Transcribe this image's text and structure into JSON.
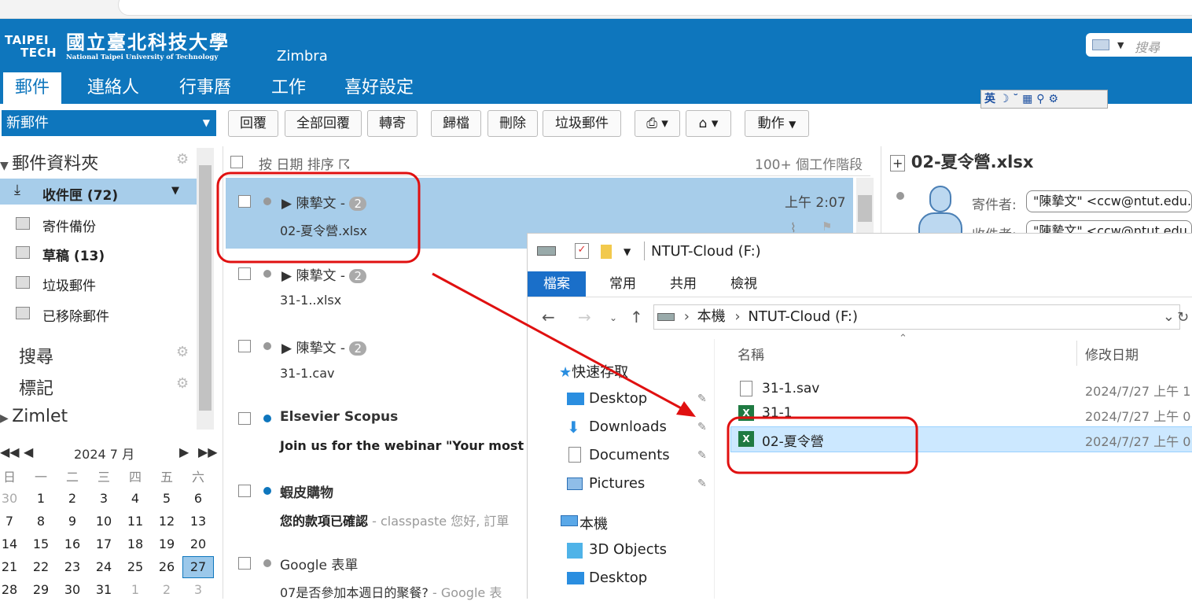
{
  "header": {
    "logo_top": "TAIPEI",
    "logo_bottom": "TECH",
    "logo_cn": "國立臺北科技大學",
    "logo_en": "National Taipei University of Technology",
    "product": "Zimbra",
    "search_placeholder": "搜尋",
    "tabs": [
      "郵件",
      "連絡人",
      "行事曆",
      "工作",
      "喜好設定"
    ],
    "ime": "英 ☽ ˘ ▦ ⚲ ⚙"
  },
  "toolbar": {
    "new_mail": "新郵件",
    "buttons": [
      "回覆",
      "全部回覆",
      "轉寄",
      "歸檔",
      "刪除",
      "垃圾郵件",
      "動作"
    ]
  },
  "sidebar": {
    "folders_header": "郵件資料夾",
    "folders": [
      {
        "label": "收件匣 (72)"
      },
      {
        "label": "寄件備份"
      },
      {
        "label": "草稿 (13)"
      },
      {
        "label": "垃圾郵件"
      },
      {
        "label": "已移除郵件"
      }
    ],
    "search": "搜尋",
    "tags": "標記",
    "zimlet": "Zimlet"
  },
  "calendar": {
    "month_label": "2024 7 月",
    "weekdays": [
      "日",
      "一",
      "二",
      "三",
      "四",
      "五",
      "六"
    ],
    "weeks": [
      [
        "30",
        "1",
        "2",
        "3",
        "4",
        "5",
        "6"
      ],
      [
        "7",
        "8",
        "9",
        "10",
        "11",
        "12",
        "13"
      ],
      [
        "14",
        "15",
        "16",
        "17",
        "18",
        "19",
        "20"
      ],
      [
        "21",
        "22",
        "23",
        "24",
        "25",
        "26",
        "27"
      ],
      [
        "28",
        "29",
        "30",
        "31",
        "1",
        "2",
        "3"
      ]
    ],
    "today": "27"
  },
  "list": {
    "sort_label": "按 日期 排序 ☈",
    "count_label": "100+ 個工作階段",
    "messages": [
      {
        "sender": "陳摯文 -",
        "count": "2",
        "subject": "02-夏令營.xlsx",
        "time": "上午 2:07"
      },
      {
        "sender": "陳摯文 -",
        "count": "2",
        "subject": "31-1..xlsx"
      },
      {
        "sender": "陳摯文 -",
        "count": "2",
        "subject": "31-1.cav"
      },
      {
        "sender": "Elsevier Scopus",
        "subject": "Join us for the webinar \"Your most as"
      },
      {
        "sender": "蝦皮購物",
        "subject": "您的款項已確認",
        "fragment": "- classpaste 您好, 訂單"
      },
      {
        "sender": "Google 表單",
        "subject": "07是否參加本週日的聚餐?",
        "fragment": "- Google 表"
      }
    ]
  },
  "reading": {
    "title": "02-夏令營.xlsx",
    "from_label": "寄件者:",
    "from_value": "\"陳摯文\" <ccw@ntut.edu.",
    "to_label": "收件者:",
    "to_value": "\"陳摯文\" <ccw@ntut.edu."
  },
  "explorer": {
    "title": "NTUT-Cloud (F:)",
    "ribbon": [
      "檔案",
      "常用",
      "共用",
      "檢視"
    ],
    "path_root": "本機",
    "path_drive": "NTUT-Cloud (F:)",
    "col_name": "名稱",
    "col_date": "修改日期",
    "tree": [
      {
        "label": "快速存取"
      },
      {
        "label": "Desktop"
      },
      {
        "label": "Downloads"
      },
      {
        "label": "Documents"
      },
      {
        "label": "Pictures"
      },
      {
        "label": "本機"
      },
      {
        "label": "3D Objects"
      },
      {
        "label": "Desktop"
      }
    ],
    "files": [
      {
        "name": "31-1.sav",
        "date": "2024/7/27 上午 1"
      },
      {
        "name": "31-1",
        "date": "2024/7/27 上午 0"
      },
      {
        "name": "02-夏令營",
        "date": "2024/7/27 上午 0"
      }
    ]
  },
  "annotation": {
    "color": "#e01010"
  }
}
